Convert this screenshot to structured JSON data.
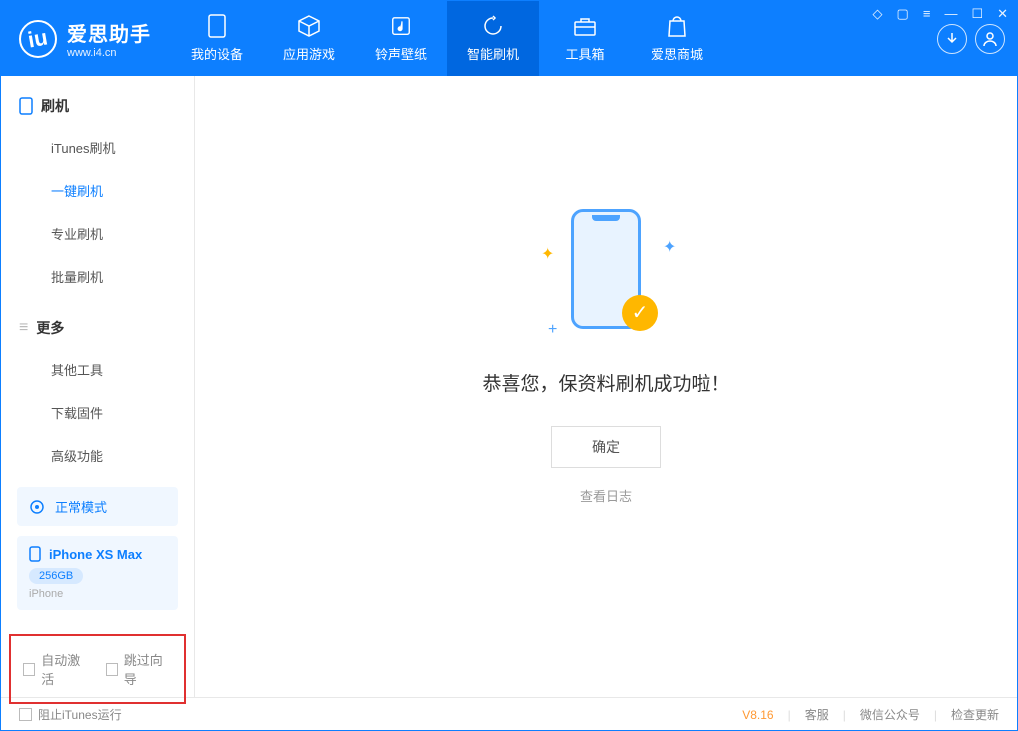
{
  "app": {
    "title": "爱思助手",
    "subtitle": "www.i4.cn"
  },
  "nav": {
    "device": "我的设备",
    "apps": "应用游戏",
    "ringtone": "铃声壁纸",
    "flash": "智能刷机",
    "toolbox": "工具箱",
    "store": "爱思商城"
  },
  "sidebar": {
    "flash_header": "刷机",
    "items": {
      "itunes": "iTunes刷机",
      "oneclick": "一键刷机",
      "pro": "专业刷机",
      "batch": "批量刷机"
    },
    "more_header": "更多",
    "more": {
      "other": "其他工具",
      "download": "下载固件",
      "advanced": "高级功能"
    }
  },
  "device": {
    "mode": "正常模式",
    "name": "iPhone XS Max",
    "storage": "256GB",
    "type": "iPhone"
  },
  "checkboxes": {
    "auto_activate": "自动激活",
    "skip_guide": "跳过向导"
  },
  "main": {
    "success": "恭喜您，保资料刷机成功啦！",
    "ok": "确定",
    "view_log": "查看日志"
  },
  "footer": {
    "block_itunes": "阻止iTunes运行",
    "version": "V8.16",
    "support": "客服",
    "wechat": "微信公众号",
    "update": "检查更新"
  }
}
